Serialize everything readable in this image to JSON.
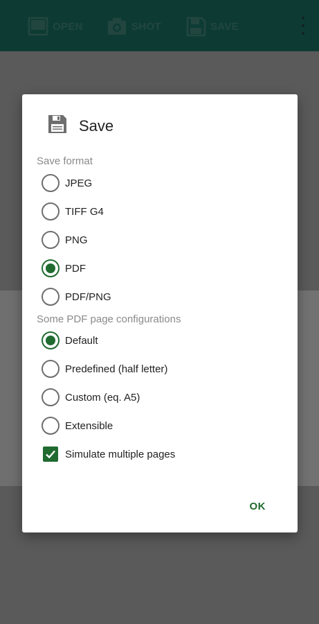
{
  "toolbar": {
    "open_label": "OPEN",
    "shot_label": "SHOT",
    "save_label": "SAVE",
    "open_icon": "image-icon",
    "shot_icon": "camera-icon",
    "save_icon": "floppy-disk-icon",
    "more_icon": "more-vert-icon"
  },
  "dialog": {
    "title": "Save",
    "title_icon": "floppy-disk-icon",
    "save_format_label": "Save format",
    "formats": [
      {
        "label": "JPEG",
        "checked": false
      },
      {
        "label": "TIFF G4",
        "checked": false
      },
      {
        "label": "PNG",
        "checked": false
      },
      {
        "label": "PDF",
        "checked": true
      },
      {
        "label": "PDF/PNG",
        "checked": false
      }
    ],
    "pdf_config_label": "Some PDF page configurations",
    "pdf_configs": [
      {
        "label": "Default",
        "checked": true
      },
      {
        "label": "Predefined (half letter)",
        "checked": false
      },
      {
        "label": "Custom (eq. A5)",
        "checked": false
      },
      {
        "label": "Extensible",
        "checked": false
      }
    ],
    "simulate_label": "Simulate multiple pages",
    "simulate_checked": true,
    "ok_label": "OK"
  },
  "colors": {
    "accent": "#1f6b30",
    "toolbar": "#0d3b34",
    "scrim_background": "#595959"
  }
}
